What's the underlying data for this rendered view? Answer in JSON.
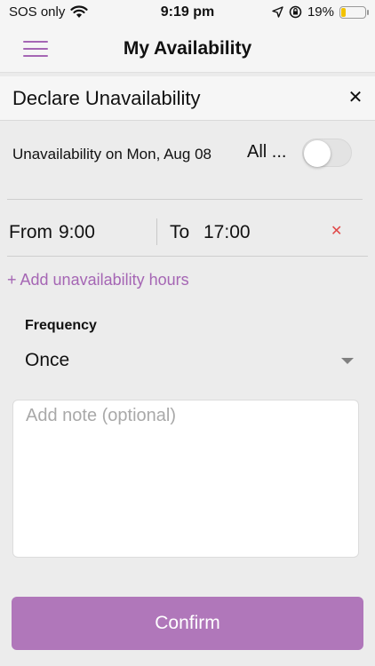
{
  "status_bar": {
    "carrier": "SOS only",
    "time": "9:19 pm",
    "battery_percent": "19%",
    "battery_level": 0.19,
    "battery_color": "#f2c200",
    "icons": [
      "wifi-icon",
      "location-arrow-icon",
      "orientation-lock-icon",
      "battery-icon"
    ]
  },
  "header": {
    "title": "My Availability",
    "menu_icon": "hamburger-menu-icon",
    "accent_color": "#a566b4"
  },
  "modal": {
    "title": "Declare Unavailability",
    "close_icon": "close-icon",
    "unavailability_label": "Unavailability on Mon, Aug 08",
    "all_day_label": "All ...",
    "all_day_enabled": false,
    "time_range": {
      "from_label": "From",
      "from_value": "9:00",
      "to_label": "To",
      "to_value": "17:00",
      "remove_icon": "remove-x-icon",
      "remove_color": "#e04848"
    },
    "add_hours_label": "+ Add unavailability hours",
    "frequency": {
      "label": "Frequency",
      "selected": "Once"
    },
    "note": {
      "placeholder": "Add note (optional)",
      "value": ""
    },
    "confirm_label": "Confirm",
    "confirm_color": "#b077ba"
  }
}
